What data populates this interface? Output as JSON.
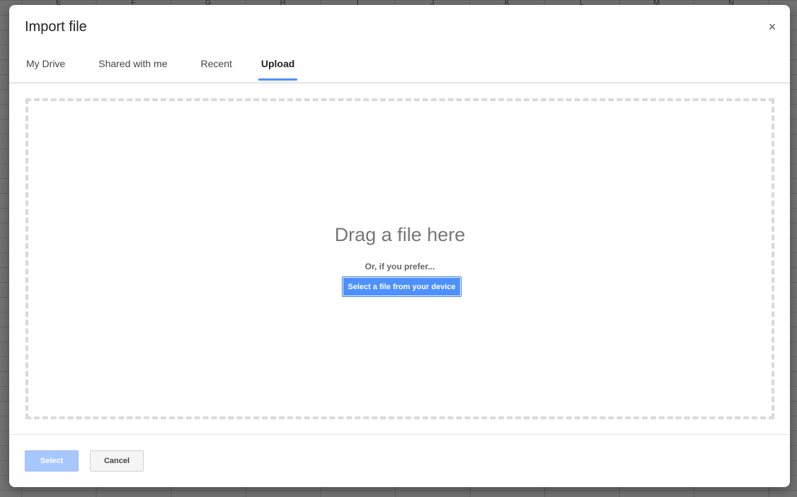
{
  "background": {
    "columns": [
      "E",
      "F",
      "G",
      "H",
      "I",
      "J",
      "K",
      "L",
      "M",
      "N"
    ]
  },
  "dialog": {
    "title": "Import file",
    "close_label": "×",
    "tabs": [
      {
        "label": "My Drive",
        "active": false
      },
      {
        "label": "Shared with me",
        "active": false
      },
      {
        "label": "Recent",
        "active": false
      },
      {
        "label": "Upload",
        "active": true
      }
    ],
    "dropzone": {
      "title": "Drag a file here",
      "subtitle": "Or, if you prefer...",
      "button_label": "Select a file from your device"
    },
    "footer": {
      "select_label": "Select",
      "cancel_label": "Cancel"
    }
  },
  "colors": {
    "accent": "#4d90fe",
    "disabled_button": "#a6c8ff"
  }
}
